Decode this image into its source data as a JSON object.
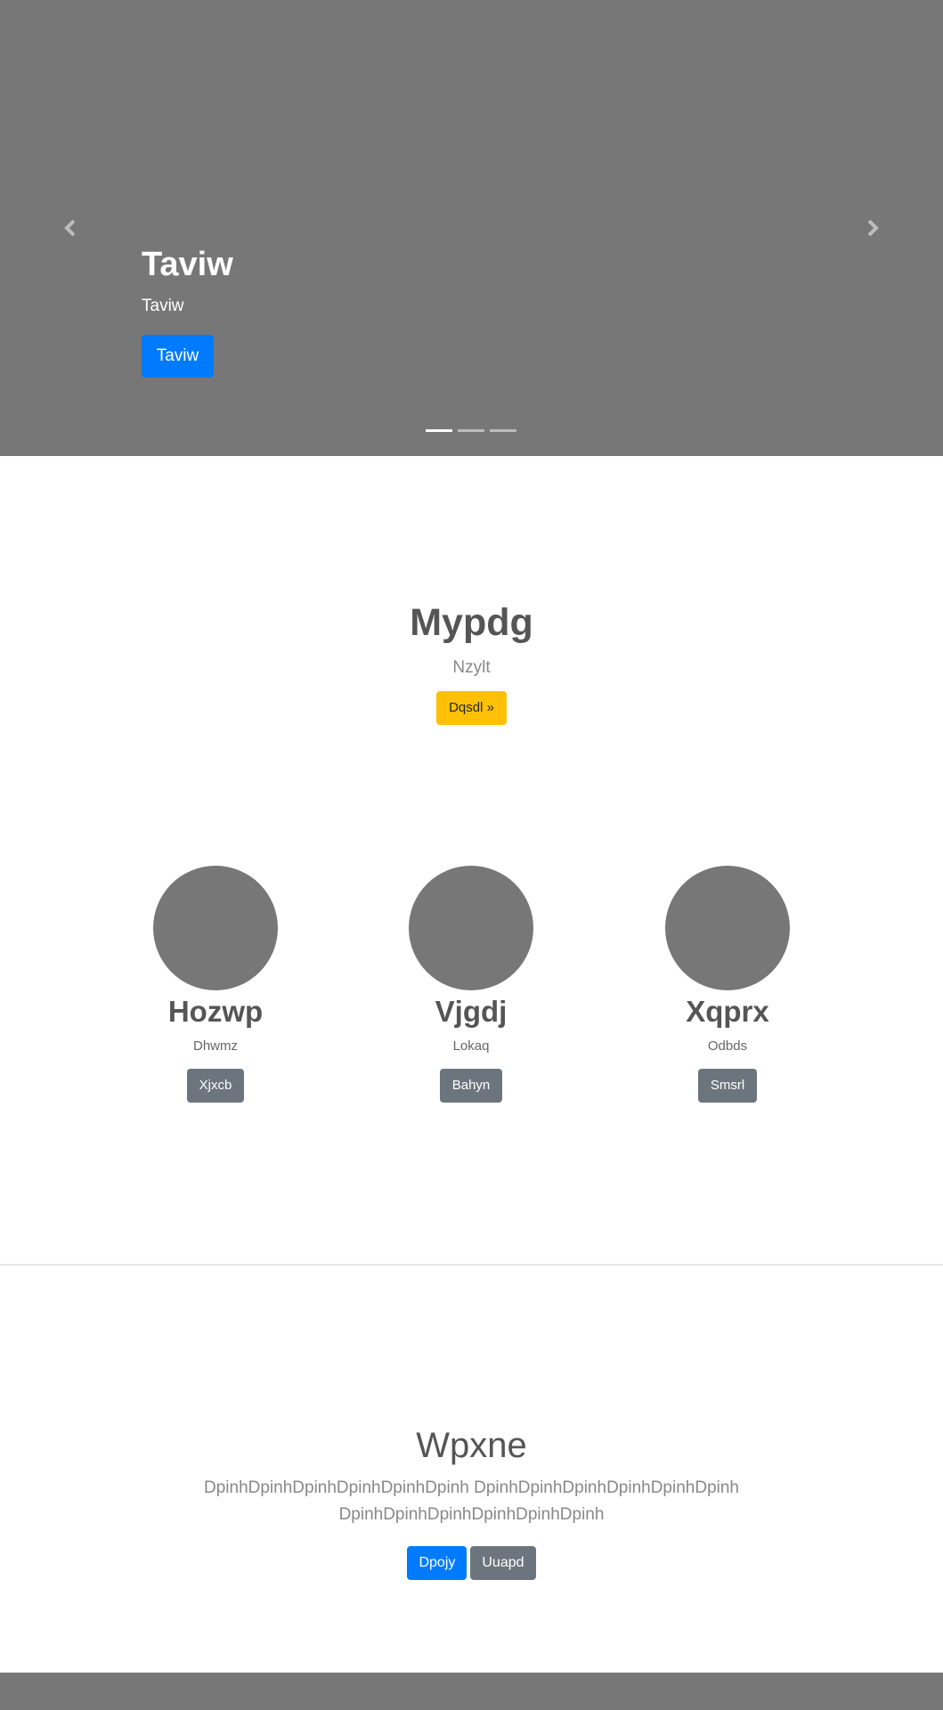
{
  "carousel": {
    "title": "Taviw",
    "text": "Taviw",
    "button_label": "Taviw",
    "prev_icon": "chevron-left-icon",
    "next_icon": "chevron-right-icon",
    "indicator_count": 3,
    "active_index": 0
  },
  "hero": {
    "title": "Mypdg",
    "subtitle": "Nzylt",
    "button_label": "Dqsdl »"
  },
  "columns": [
    {
      "title": "Hozwp",
      "subtitle": "Dhwmz",
      "button_label": "Xjxcb"
    },
    {
      "title": "Vjgdj",
      "subtitle": "Lokaq",
      "button_label": "Bahyn"
    },
    {
      "title": "Xqprx",
      "subtitle": "Odbds",
      "button_label": "Smsrl"
    }
  ],
  "lead": {
    "title": "Wpxne",
    "text": "DpinhDpinhDpinhDpinhDpinhDpinh DpinhDpinhDpinhDpinhDpinhDpinh DpinhDpinhDpinhDpinhDpinhDpinh",
    "primary_button": "Dpojy",
    "secondary_button": "Uuapd"
  },
  "colors": {
    "placeholder_gray": "#777777",
    "primary": "#007bff",
    "secondary": "#6c757d",
    "warning": "#ffc107"
  }
}
